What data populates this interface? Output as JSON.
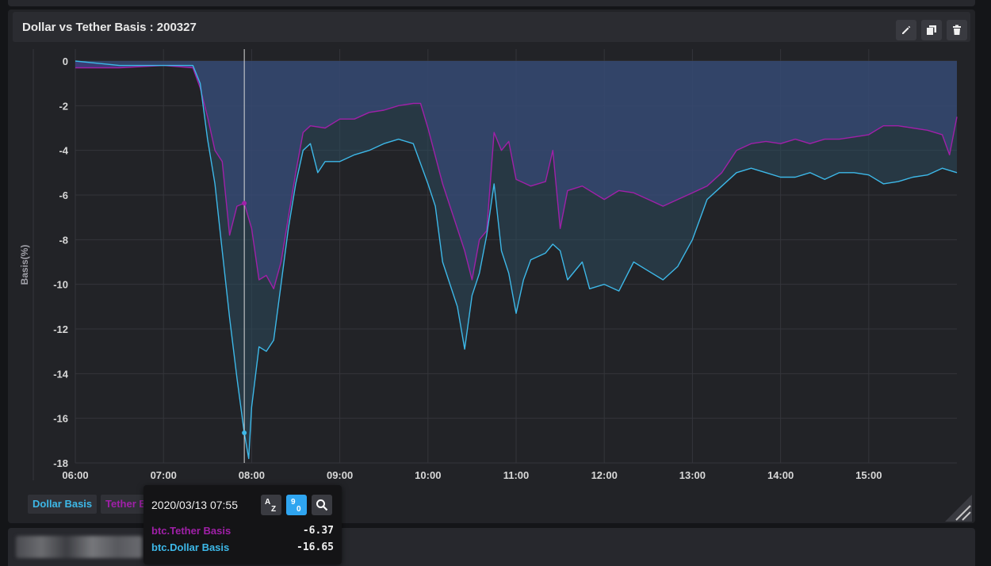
{
  "panel": {
    "title": "Dollar vs Tether Basis : 200327",
    "actions": [
      {
        "name": "edit",
        "icon": "pencil-icon"
      },
      {
        "name": "duplicate",
        "icon": "copy-icon"
      },
      {
        "name": "delete",
        "icon": "trash-icon"
      }
    ]
  },
  "legend": [
    {
      "label": "Dollar Basis",
      "color": "#3db8e8"
    },
    {
      "label": "Tether Basis",
      "color": "#a020a8"
    }
  ],
  "tooltip": {
    "date": "2020/03/13 07:55",
    "sort_alpha_label": "A Z",
    "sort_num_label": "9 0",
    "rows": [
      {
        "name": "btc.Tether Basis",
        "value": "-6.37",
        "color": "#a020a8"
      },
      {
        "name": "btc.Dollar Basis",
        "value": "-16.65",
        "color": "#3db8e8"
      }
    ]
  },
  "chart_data": {
    "type": "line",
    "ylabel": "Basis(%)",
    "ylim": [
      -18,
      0
    ],
    "yticks": [
      0,
      -2,
      -4,
      -6,
      -8,
      -10,
      -12,
      -14,
      -16,
      -18
    ],
    "xlim": [
      "06:00",
      "16:00"
    ],
    "xticks": [
      "06:00",
      "07:00",
      "08:00",
      "09:00",
      "10:00",
      "11:00",
      "12:00",
      "13:00",
      "14:00",
      "15:00"
    ],
    "cursor_time": "07:55",
    "series": [
      {
        "name": "btc.Tether Basis",
        "color": "#a020a8",
        "fill": "#4a4aa0",
        "points": [
          [
            "06:00",
            -0.3
          ],
          [
            "06:30",
            -0.3
          ],
          [
            "07:00",
            -0.2
          ],
          [
            "07:20",
            -0.3
          ],
          [
            "07:25",
            -1.2
          ],
          [
            "07:30",
            -2.5
          ],
          [
            "07:35",
            -4.0
          ],
          [
            "07:40",
            -4.5
          ],
          [
            "07:45",
            -7.8
          ],
          [
            "07:50",
            -6.5
          ],
          [
            "07:55",
            -6.37
          ],
          [
            "08:00",
            -7.5
          ],
          [
            "08:05",
            -9.8
          ],
          [
            "08:10",
            -9.6
          ],
          [
            "08:15",
            -10.2
          ],
          [
            "08:20",
            -9.0
          ],
          [
            "08:25",
            -7.0
          ],
          [
            "08:30",
            -5.0
          ],
          [
            "08:35",
            -3.2
          ],
          [
            "08:40",
            -2.9
          ],
          [
            "08:50",
            -3.0
          ],
          [
            "09:00",
            -2.6
          ],
          [
            "09:10",
            -2.6
          ],
          [
            "09:20",
            -2.3
          ],
          [
            "09:30",
            -2.2
          ],
          [
            "09:40",
            -2.0
          ],
          [
            "09:50",
            -1.9
          ],
          [
            "09:55",
            -1.9
          ],
          [
            "10:00",
            -3.0
          ],
          [
            "10:10",
            -5.5
          ],
          [
            "10:20",
            -7.5
          ],
          [
            "10:25",
            -8.5
          ],
          [
            "10:30",
            -9.8
          ],
          [
            "10:35",
            -8.0
          ],
          [
            "10:40",
            -7.6
          ],
          [
            "10:45",
            -3.2
          ],
          [
            "10:50",
            -4.0
          ],
          [
            "10:55",
            -3.6
          ],
          [
            "11:00",
            -5.3
          ],
          [
            "11:10",
            -5.6
          ],
          [
            "11:20",
            -5.4
          ],
          [
            "11:25",
            -4.0
          ],
          [
            "11:30",
            -7.5
          ],
          [
            "11:35",
            -5.8
          ],
          [
            "11:45",
            -5.6
          ],
          [
            "12:00",
            -6.2
          ],
          [
            "12:10",
            -5.8
          ],
          [
            "12:20",
            -5.9
          ],
          [
            "12:30",
            -6.2
          ],
          [
            "12:40",
            -6.5
          ],
          [
            "12:50",
            -6.2
          ],
          [
            "13:00",
            -5.9
          ],
          [
            "13:10",
            -5.6
          ],
          [
            "13:20",
            -5.0
          ],
          [
            "13:30",
            -4.0
          ],
          [
            "13:40",
            -3.7
          ],
          [
            "13:50",
            -3.6
          ],
          [
            "14:00",
            -3.7
          ],
          [
            "14:10",
            -3.5
          ],
          [
            "14:20",
            -3.7
          ],
          [
            "14:30",
            -3.5
          ],
          [
            "14:40",
            -3.5
          ],
          [
            "14:50",
            -3.4
          ],
          [
            "15:00",
            -3.3
          ],
          [
            "15:10",
            -2.9
          ],
          [
            "15:20",
            -2.9
          ],
          [
            "15:30",
            -3.0
          ],
          [
            "15:40",
            -3.1
          ],
          [
            "15:50",
            -3.3
          ],
          [
            "15:55",
            -4.2
          ],
          [
            "16:00",
            -2.5
          ]
        ]
      },
      {
        "name": "btc.Dollar Basis",
        "color": "#3db8e8",
        "fill": "#2c4a5c",
        "points": [
          [
            "06:00",
            0.0
          ],
          [
            "06:30",
            -0.2
          ],
          [
            "07:00",
            -0.2
          ],
          [
            "07:20",
            -0.2
          ],
          [
            "07:25",
            -1.0
          ],
          [
            "07:30",
            -3.5
          ],
          [
            "07:35",
            -5.5
          ],
          [
            "07:40",
            -8.5
          ],
          [
            "07:45",
            -11.5
          ],
          [
            "07:50",
            -14.2
          ],
          [
            "07:55",
            -16.65
          ],
          [
            "07:58",
            -17.8
          ],
          [
            "08:00",
            -15.5
          ],
          [
            "08:05",
            -12.8
          ],
          [
            "08:10",
            -13.0
          ],
          [
            "08:15",
            -12.5
          ],
          [
            "08:20",
            -10.0
          ],
          [
            "08:25",
            -7.5
          ],
          [
            "08:30",
            -5.5
          ],
          [
            "08:35",
            -4.0
          ],
          [
            "08:40",
            -3.7
          ],
          [
            "08:45",
            -5.0
          ],
          [
            "08:50",
            -4.5
          ],
          [
            "09:00",
            -4.5
          ],
          [
            "09:10",
            -4.2
          ],
          [
            "09:20",
            -4.0
          ],
          [
            "09:30",
            -3.7
          ],
          [
            "09:40",
            -3.5
          ],
          [
            "09:50",
            -3.7
          ],
          [
            "10:00",
            -5.5
          ],
          [
            "10:05",
            -6.5
          ],
          [
            "10:10",
            -9.0
          ],
          [
            "10:20",
            -11.0
          ],
          [
            "10:25",
            -12.9
          ],
          [
            "10:30",
            -10.5
          ],
          [
            "10:35",
            -9.5
          ],
          [
            "10:40",
            -7.8
          ],
          [
            "10:45",
            -5.5
          ],
          [
            "10:50",
            -8.5
          ],
          [
            "10:55",
            -9.5
          ],
          [
            "11:00",
            -11.3
          ],
          [
            "11:05",
            -9.8
          ],
          [
            "11:10",
            -8.9
          ],
          [
            "11:20",
            -8.6
          ],
          [
            "11:25",
            -8.2
          ],
          [
            "11:30",
            -8.5
          ],
          [
            "11:35",
            -9.8
          ],
          [
            "11:45",
            -9.0
          ],
          [
            "11:50",
            -10.2
          ],
          [
            "12:00",
            -10.0
          ],
          [
            "12:10",
            -10.3
          ],
          [
            "12:20",
            -9.0
          ],
          [
            "12:30",
            -9.4
          ],
          [
            "12:40",
            -9.8
          ],
          [
            "12:50",
            -9.2
          ],
          [
            "13:00",
            -8.0
          ],
          [
            "13:10",
            -6.2
          ],
          [
            "13:20",
            -5.6
          ],
          [
            "13:30",
            -5.0
          ],
          [
            "13:40",
            -4.8
          ],
          [
            "13:50",
            -5.0
          ],
          [
            "14:00",
            -5.2
          ],
          [
            "14:10",
            -5.2
          ],
          [
            "14:20",
            -5.0
          ],
          [
            "14:30",
            -5.3
          ],
          [
            "14:40",
            -5.0
          ],
          [
            "14:50",
            -5.0
          ],
          [
            "15:00",
            -5.1
          ],
          [
            "15:10",
            -5.5
          ],
          [
            "15:20",
            -5.4
          ],
          [
            "15:30",
            -5.2
          ],
          [
            "15:40",
            -5.1
          ],
          [
            "15:50",
            -4.8
          ],
          [
            "16:00",
            -5.0
          ]
        ]
      }
    ]
  }
}
